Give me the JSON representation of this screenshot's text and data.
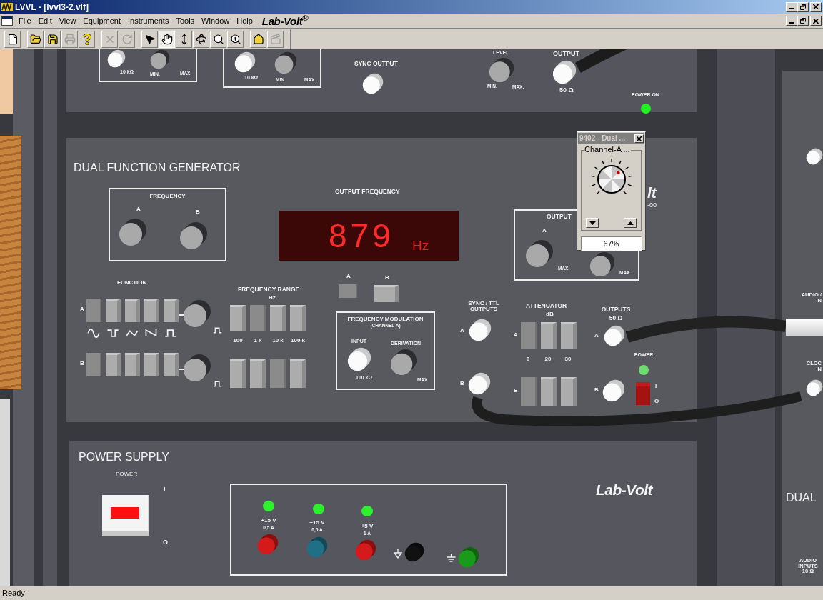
{
  "window": {
    "title": "LVVL - [lvvl3-2.vlf]"
  },
  "menu_bar": {
    "items": [
      "File",
      "Edit",
      "View",
      "Equipment",
      "Instruments",
      "Tools",
      "Window",
      "Help"
    ],
    "logo": "Lab-Volt$^{®}$"
  },
  "toolbar": {
    "groups": [
      [
        {
          "kind": "new",
          "selected": false,
          "disabled": false
        }
      ],
      [
        {
          "kind": "open",
          "selected": false,
          "disabled": false
        },
        {
          "kind": "save",
          "selected": false,
          "disabled": false
        },
        {
          "kind": "print",
          "selected": false,
          "disabled": true
        },
        {
          "kind": "help",
          "selected": false,
          "disabled": false
        }
      ],
      [
        {
          "kind": "delete",
          "selected": false,
          "disabled": true
        },
        {
          "kind": "redo",
          "selected": false,
          "disabled": true
        }
      ],
      [
        {
          "kind": "pointer",
          "selected": false,
          "disabled": false
        },
        {
          "kind": "hand",
          "selected": true,
          "disabled": false
        },
        {
          "kind": "lift",
          "selected": false,
          "disabled": false
        },
        {
          "kind": "orbit",
          "selected": false,
          "disabled": false
        },
        {
          "kind": "zoom",
          "selected": false,
          "disabled": false
        },
        {
          "kind": "zoom_extents",
          "selected": false,
          "disabled": false
        }
      ],
      [
        {
          "kind": "home",
          "selected": false,
          "disabled": false
        },
        {
          "kind": "camera",
          "selected": false,
          "disabled": true
        }
      ]
    ]
  },
  "upper_module": {
    "pot_boxes": [
      {
        "jack_label": "10 kΩ",
        "min": "MIN.",
        "max": "MAX."
      },
      {
        "jack_label": "10 kΩ",
        "min": "MIN.",
        "max": "MAX."
      }
    ],
    "sync_output": "SYNC OUTPUT",
    "level": {
      "label": "LEVEL",
      "min": "MIN.",
      "max": "MAX."
    },
    "output": {
      "label": "OUTPUT",
      "impedance": "50 Ω"
    },
    "power_on": {
      "label": "POWER ON",
      "lit": true
    }
  },
  "function_generator": {
    "title": "DUAL FUNCTION GENERATOR",
    "frequency": {
      "label": "FREQUENCY",
      "channels": [
        "A",
        "B"
      ]
    },
    "display": {
      "label": "OUTPUT FREQUENCY",
      "value": "879",
      "unit": "Hz"
    },
    "display_select": [
      {
        "label": "A",
        "selected": true
      },
      {
        "label": "B",
        "selected": false
      }
    ],
    "function": {
      "label": "FUNCTION",
      "rows": [
        {
          "channel": "A",
          "buttons": [
            {
              "selected": true
            },
            {
              "selected": false
            },
            {
              "selected": false
            },
            {
              "selected": false
            },
            {
              "selected": false
            }
          ]
        },
        {
          "channel": "B",
          "buttons": [
            {
              "selected": true
            },
            {
              "selected": false
            },
            {
              "selected": false
            },
            {
              "selected": false
            },
            {
              "selected": false
            }
          ]
        }
      ],
      "waveforms": [
        {
          "kind": "sine"
        },
        {
          "kind": "square"
        },
        {
          "kind": "triangle"
        },
        {
          "kind": "sawtooth"
        },
        {
          "kind": "pulse"
        }
      ]
    },
    "frequency_range": {
      "label": "FREQUENCY RANGE",
      "unit": "Hz",
      "rows": [
        {
          "buttons": [
            {
              "selected": false
            },
            {
              "selected": true
            },
            {
              "selected": false
            },
            {
              "selected": false
            }
          ]
        },
        {
          "buttons": [
            {
              "selected": false
            },
            {
              "selected": false
            },
            {
              "selected": true
            },
            {
              "selected": false
            }
          ]
        }
      ],
      "scale": [
        "100",
        "1 k",
        "10 k",
        "100 k"
      ]
    },
    "modulation": {
      "label": "FREQUENCY MODULATION",
      "sublabel": "(CHANNEL A)",
      "input_label": "INPUT",
      "input_value": "100 kΩ",
      "derivation_label": "DERIVATION",
      "derivation_max": "MAX."
    },
    "output": {
      "label": "OUTPUT",
      "channel": "A",
      "max": [
        "MAX.",
        "MAX."
      ]
    },
    "sync_ttl": {
      "label": [
        "SYNC / TTL",
        "OUTPUTS"
      ],
      "channels": [
        "A",
        "B"
      ]
    },
    "attenuator": {
      "label": "ATTENUATOR",
      "unit": "dB",
      "rows": [
        {
          "channel": "A",
          "buttons": [
            {
              "selected": true
            },
            {
              "selected": false
            },
            {
              "selected": false
            }
          ]
        },
        {
          "channel": "B",
          "buttons": [
            {
              "selected": true
            },
            {
              "selected": false
            },
            {
              "selected": false
            }
          ]
        }
      ],
      "scale": [
        "0",
        "20",
        "30"
      ]
    },
    "outputs": {
      "label": "OUTPUTS",
      "impedance": "50 Ω",
      "channels": [
        "A",
        "B"
      ]
    },
    "power": {
      "label": "POWER",
      "on": true,
      "marks": [
        "I",
        "O"
      ]
    },
    "logo_fragment": "lt",
    "model_fragment": "-00"
  },
  "dialog": {
    "title": "9402 - Dual ...",
    "group": "Channel-A ...",
    "dial": {
      "level": 0.67
    },
    "value": "67%"
  },
  "power_supply": {
    "title": "POWER SUPPLY",
    "switch": {
      "label": "POWER",
      "on": true,
      "marks": [
        "I",
        "O"
      ]
    },
    "terminals": [
      {
        "kind": "supply",
        "voltage": "+15 V",
        "current": "0,5 A",
        "lit": true,
        "color": "#d41a1a"
      },
      {
        "kind": "supply",
        "voltage": "−15 V",
        "current": "0,5 A",
        "lit": true,
        "color": "#1f6f86"
      },
      {
        "kind": "supply",
        "voltage": "+5 V",
        "current": "1 A",
        "lit": true,
        "color": "#d41a1a"
      },
      {
        "kind": "common",
        "color": "#111111"
      },
      {
        "kind": "earth",
        "color": "#1a9a1a"
      }
    ],
    "logo": "Lab-Volt"
  },
  "side_unit": {
    "labels": [
      {
        "lines": [
          "AUDIO /",
          "IN"
        ]
      },
      {
        "lines": [
          "CLOC",
          "IN"
        ]
      }
    ],
    "title": "DUAL",
    "inputs": {
      "lines": [
        "AUDIO",
        "INPUTS",
        "10 Ω"
      ]
    }
  },
  "status_bar": {
    "text": "Ready"
  }
}
